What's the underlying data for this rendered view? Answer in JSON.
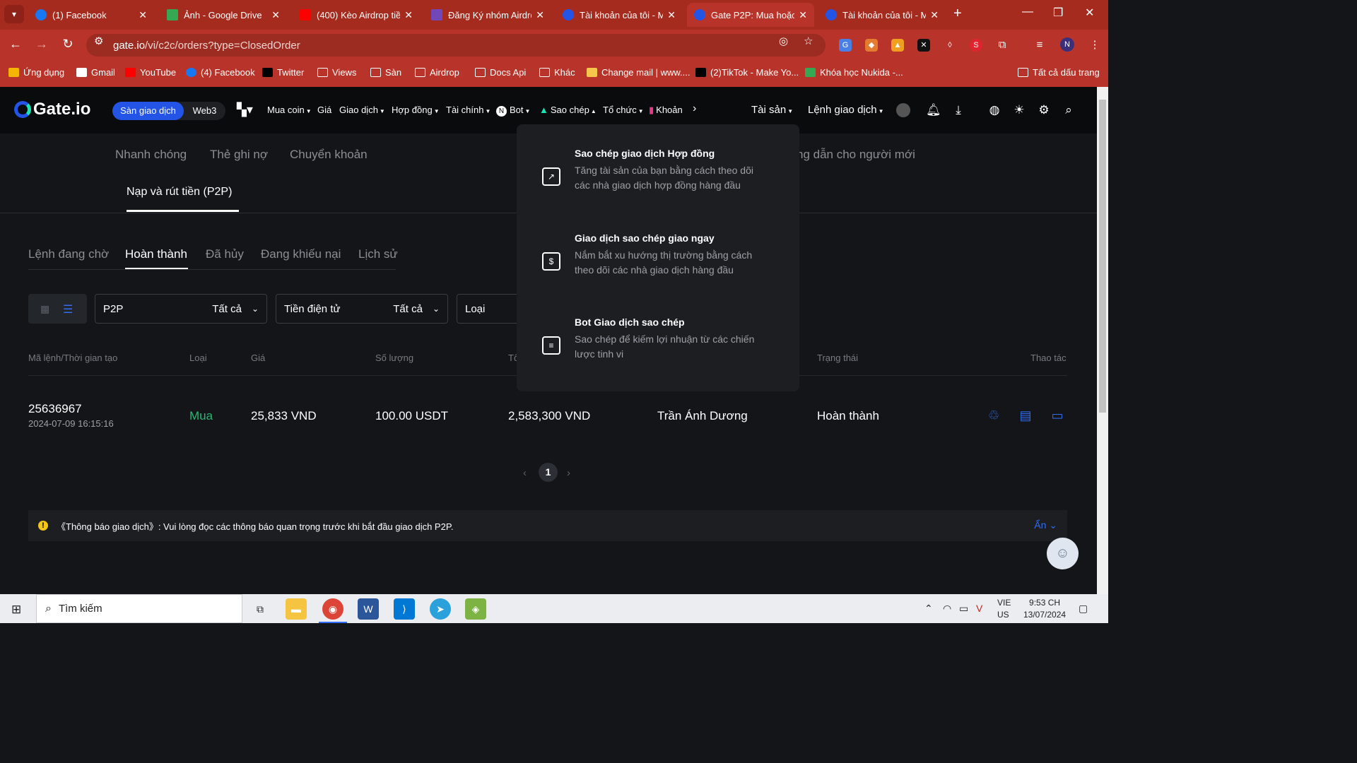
{
  "browser": {
    "tabs": [
      {
        "title": "(1) Facebook",
        "color": "#1877f2"
      },
      {
        "title": "Ảnh - Google Drive",
        "color": "#34a853"
      },
      {
        "title": "(400) Kèo Airdrop tiền",
        "color": "#ff0000"
      },
      {
        "title": "Đăng Ký nhóm Airdro",
        "color": "#7248b9"
      },
      {
        "title": "Tài khoản của tôi - M",
        "color": "#2354e6"
      },
      {
        "title": "Gate P2P: Mua hoặc",
        "color": "#2354e6"
      },
      {
        "title": "Tài khoản của tôi - M",
        "color": "#2354e6"
      }
    ],
    "new_tab": "+",
    "url_host": "gate.io",
    "url_path": "/vi/c2c/orders?type=ClosedOrder",
    "profile_initial": "N",
    "bookmarks": [
      "Ứng dụng",
      "Gmail",
      "YouTube",
      "(4) Facebook",
      "Twitter",
      "Views",
      "Sàn",
      "Airdrop",
      "Docs Api",
      "Khác",
      "Change mail | www....",
      "(2)TikTok - Make Yo...",
      "Khóa học Nukida -..."
    ],
    "all_bookmarks": "Tất cả dấu trang"
  },
  "header": {
    "logo": "Gate.io",
    "switch_on": "Sàn giao dịch",
    "switch_off": "Web3",
    "nav": [
      "Mua coin",
      "Giá",
      "Giao dịch",
      "Hợp đồng",
      "Tài chính",
      "Bot",
      "Sao chép",
      "Tổ chức",
      "Khoản"
    ],
    "assets": "Tài sản",
    "orders": "Lệnh giao dịch"
  },
  "subnav": {
    "items": [
      "Nhanh chóng",
      "Thẻ ghi nợ",
      "Chuyển khoản"
    ],
    "guide": "ng dẫn cho người mới",
    "active": "Nạp và rút tiền (P2P)"
  },
  "order_tabs": [
    "Lệnh đang chờ",
    "Hoàn thành",
    "Đã hủy",
    "Đang khiếu nại",
    "Lịch sử"
  ],
  "filters": {
    "f1_label": "P2P",
    "f1_value": "Tất cả",
    "f2_label": "Tiền điện tử",
    "f2_value": "Tất cả",
    "f3_label": "Loại"
  },
  "table": {
    "headers": [
      "Mã lệnh/Thời gian tạo",
      "Loại",
      "Giá",
      "Số lượng",
      "Tổ",
      "Trạng thái",
      "Thao tác"
    ],
    "row": {
      "id": "25636967",
      "time": "2024-07-09 16:15:16",
      "type": "Mua",
      "price": "25,833 VND",
      "amount": "100.00 USDT",
      "total": "2,583,300 VND",
      "counterparty": "Trần Ánh Dương",
      "status": "Hoàn thành"
    }
  },
  "pager": {
    "current": "1"
  },
  "notice": {
    "text": "《Thông báo giao dịch》: Vui lòng đọc các thông báo quan trọng trước khi bắt đầu giao dịch P2P.",
    "hide": "Ẩn"
  },
  "dropdown": [
    {
      "title": "Sao chép giao dịch Hợp đồng",
      "desc": "Tăng tài sản của bạn bằng cách theo dõi các nhà giao dịch hợp đồng hàng đầu"
    },
    {
      "title": "Giao dịch sao chép giao ngay",
      "desc": "Nắm bắt xu hướng thị trường bằng cách theo dõi các nhà giao dịch hàng đầu"
    },
    {
      "title": "Bot Giao dịch sao chép",
      "desc": "Sao chép để kiếm lợi nhuận từ các chiến lược tinh vi"
    }
  ],
  "taskbar": {
    "search": "Tìm kiếm",
    "lang1": "VIE",
    "lang2": "US",
    "time": "9:53 CH",
    "date": "13/07/2024"
  },
  "colors": {
    "accent": "#2354e6",
    "buy": "#2bb673",
    "chrome": "#b8342a"
  }
}
